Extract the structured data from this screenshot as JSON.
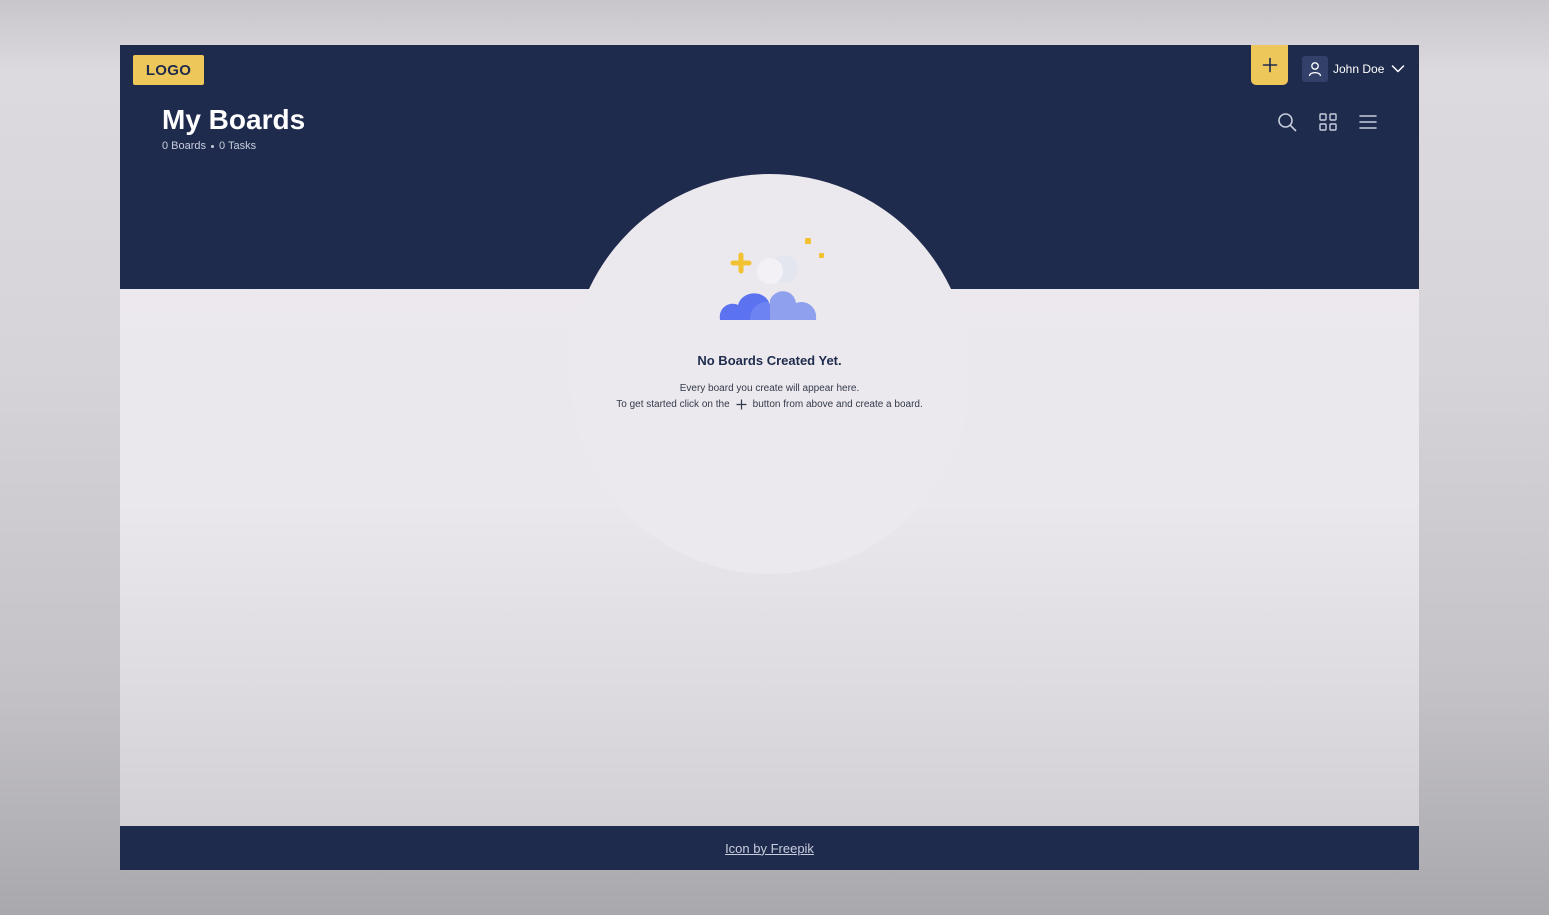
{
  "header": {
    "logo_text": "LOGO",
    "user_name": "John Doe",
    "title": "My Boards",
    "boards_count": "0 Boards",
    "tasks_count": "0 Tasks"
  },
  "icons": {
    "add": "plus-icon",
    "user": "user-icon",
    "dropdown": "chevron-down-icon",
    "search": "search-icon",
    "grid_view": "grid-icon",
    "list_view": "menu-icon",
    "empty_state": "cloud-icon"
  },
  "empty_state": {
    "title": "No Boards Created Yet.",
    "line1": "Every board you create will appear here.",
    "line2_before": "To get started click on the",
    "line2_after": "button from above and create a board."
  },
  "footer": {
    "credit_link": "Icon by Freepik"
  },
  "colors": {
    "navy": "#1f2b4d",
    "accent": "#edc75a",
    "cloud_dark": "#5b73f0",
    "cloud_light": "#8fa0ef"
  }
}
